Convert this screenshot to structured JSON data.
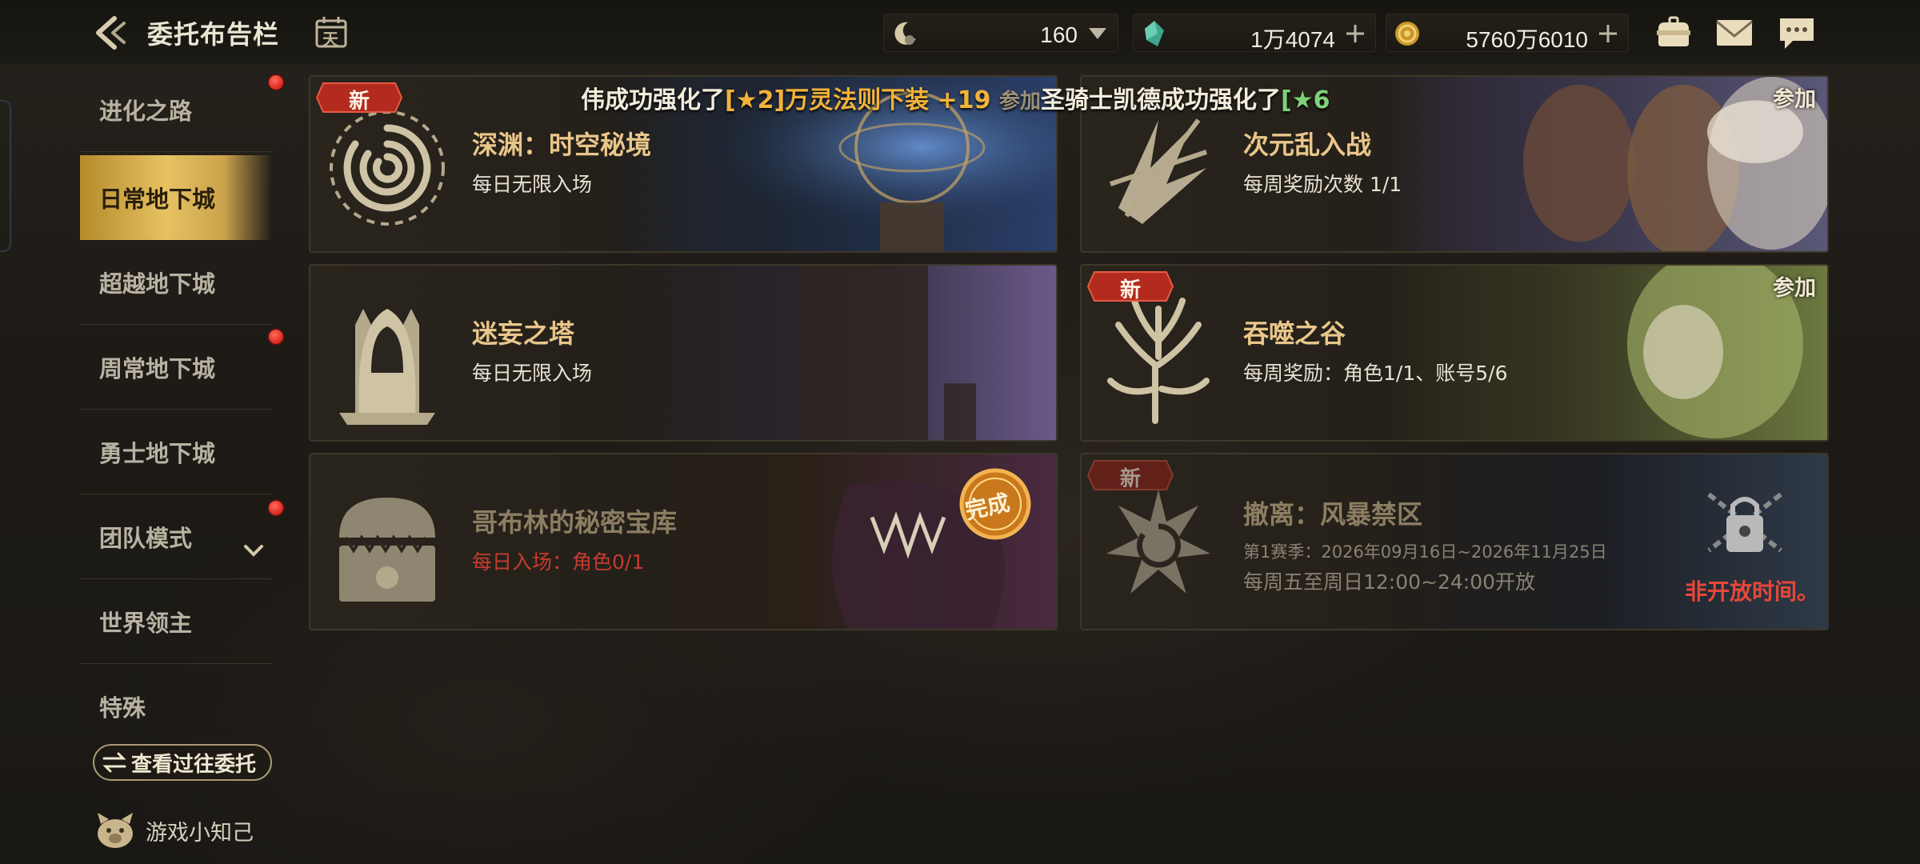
{
  "header": {
    "title": "委托布告栏",
    "calendar_glyph": "天"
  },
  "resources": [
    {
      "name": "fatigue",
      "value": "160",
      "icon": "fatigue-moon-icon",
      "action": "dropdown"
    },
    {
      "name": "crystal",
      "value": "1万4074",
      "icon": "green-crystal-icon",
      "action": "add"
    },
    {
      "name": "gold",
      "value": "5760万6010",
      "icon": "gold-coin-icon",
      "action": "add"
    }
  ],
  "top_icons": [
    "bag-icon",
    "mail-icon",
    "chat-icon"
  ],
  "sidebar": {
    "items": [
      {
        "label": "进化之路",
        "badge": true
      },
      {
        "label": "日常地下城",
        "active": true
      },
      {
        "label": "超越地下城"
      },
      {
        "label": "周常地下城",
        "badge": true
      },
      {
        "label": "勇士地下城"
      },
      {
        "label": "团队模式",
        "badge": true,
        "expandable": true
      },
      {
        "label": "世界领主"
      },
      {
        "label": "特殊"
      }
    ],
    "history_button": "查看过往委托",
    "tips_label": "游戏小知己"
  },
  "notice": {
    "p1": "伟成功强化了",
    "p2": "[★2]万灵法则下装 +19",
    "p3": "参加",
    "p4": "圣骑士凯德成功强化了",
    "p5": "[★6"
  },
  "cards": [
    {
      "title": "深渊：时空秘境",
      "sub": "每日无限入场",
      "new_badge": "新",
      "icon": "abyss-vortex-icon"
    },
    {
      "title": "次元乱入战",
      "sub": "每周奖励次数 1/1",
      "join": "参加",
      "icon": "dimension-claw-icon"
    },
    {
      "title": "迷妄之塔",
      "sub": "每日无限入场",
      "icon": "hooded-tower-icon"
    },
    {
      "title": "吞噬之谷",
      "sub": "每周奖励：角色1/1、账号5/6",
      "new_badge": "新",
      "join": "参加",
      "icon": "withered-tree-icon"
    },
    {
      "title": "哥布林的秘密宝库",
      "sub": "每日入场：角色0/1",
      "complete": "完成",
      "icon": "mimic-chest-icon",
      "sub_color": "#c53c30"
    },
    {
      "title": "撤离：风暴禁区",
      "season": "第1赛季：2026年09月16日~2026年11月25日",
      "sub": "每周五至周日12:00~24:00开放",
      "new_badge": "新",
      "status": "非开放时间。",
      "icon": "storm-vortex-icon",
      "status_color": "#e8473a"
    }
  ]
}
